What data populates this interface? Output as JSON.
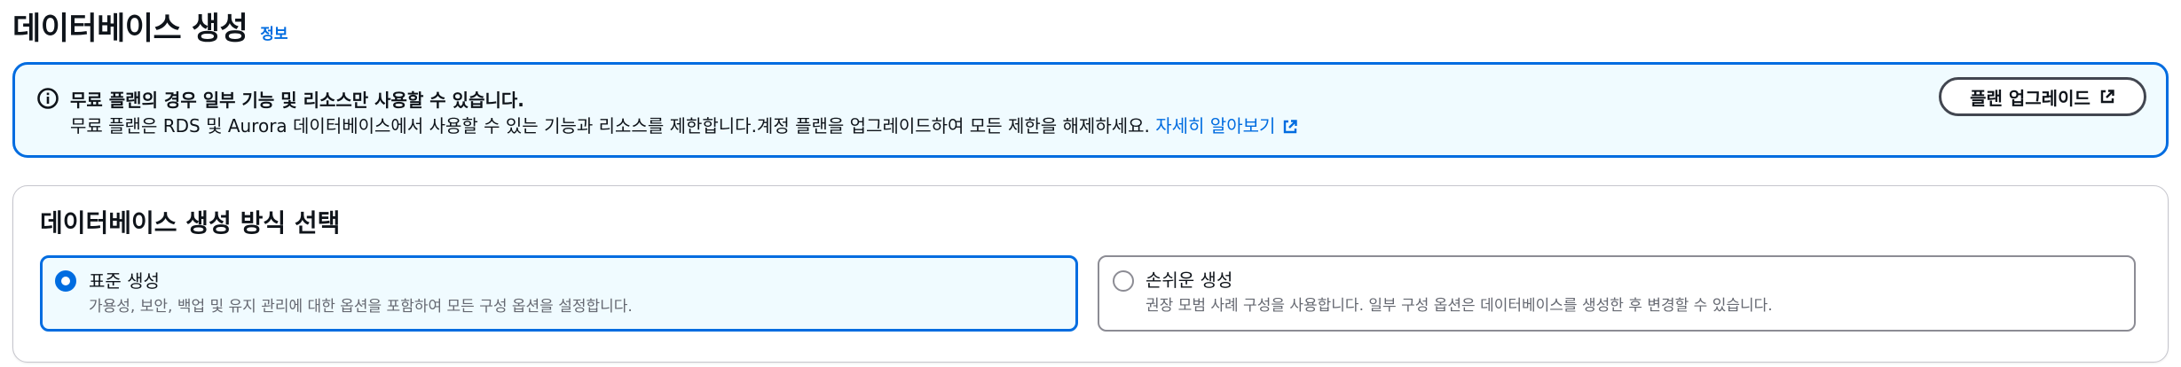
{
  "header": {
    "title": "데이터베이스 생성",
    "info_link": "정보"
  },
  "alert": {
    "icon": "info-icon",
    "title": "무료 플랜의 경우 일부 기능 및 리소스만 사용할 수 있습니다.",
    "body": "무료 플랜은 RDS 및 Aurora 데이터베이스에서 사용할 수 있는 기능과 리소스를 제한합니다.계정 플랜을 업그레이드하여 모든 제한을 해제하세요.",
    "learn_more": "자세히 알아보기",
    "upgrade_button": "플랜 업그레이드",
    "colors": {
      "accent": "#006ce0",
      "background": "#f0fbff"
    }
  },
  "creation_method": {
    "title": "데이터베이스 생성 방식 선택",
    "options": [
      {
        "title": "표준 생성",
        "description": "가용성, 보안, 백업 및 유지 관리에 대한 옵션을 포함하여 모든 구성 옵션을 설정합니다.",
        "selected": true
      },
      {
        "title": "손쉬운 생성",
        "description": "권장 모범 사례 구성을 사용합니다. 일부 구성 옵션은 데이터베이스를 생성한 후 변경할 수 있습니다.",
        "selected": false
      }
    ]
  }
}
